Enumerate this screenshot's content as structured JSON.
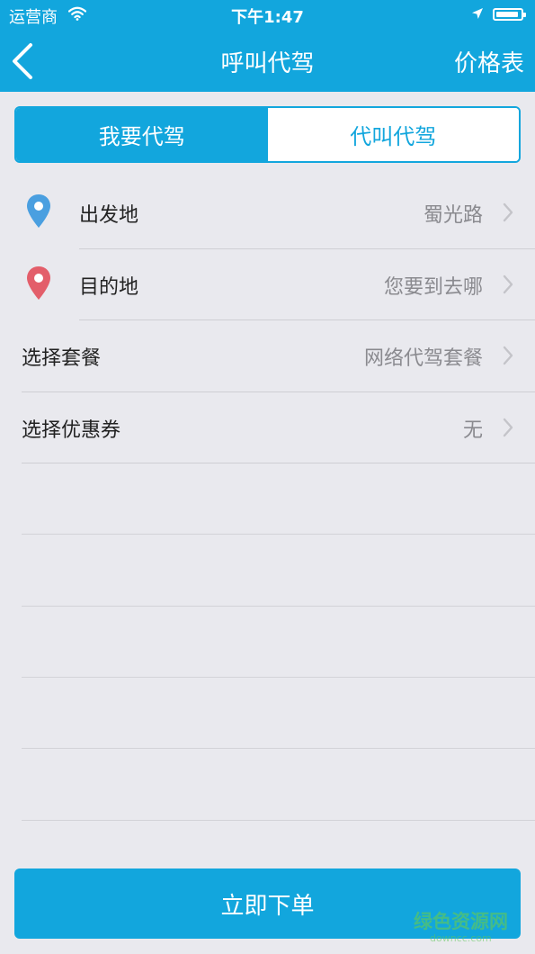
{
  "status_bar": {
    "carrier": "运营商",
    "time": "下午1:47",
    "battery_level": 0.92
  },
  "nav": {
    "title": "呼叫代驾",
    "right_action": "价格表"
  },
  "segments": [
    {
      "label": "我要代驾",
      "selected": true
    },
    {
      "label": "代叫代驾",
      "selected": false
    }
  ],
  "form": {
    "departure": {
      "label": "出发地",
      "value": "蜀光路"
    },
    "destination": {
      "label": "目的地",
      "value": "您要到去哪"
    },
    "package": {
      "label": "选择套餐",
      "value": "网络代驾套餐"
    },
    "coupon": {
      "label": "选择优惠券",
      "value": "无"
    }
  },
  "submit_label": "立即下单",
  "watermark": {
    "text": "绿色资源网",
    "sub": "downcc.com"
  },
  "colors": {
    "primary": "#12a6dd",
    "background": "#e9e9ee",
    "departure_pin": "#4a9fe0",
    "destination_pin": "#e35e6a"
  },
  "icons": [
    "back-arrow-icon",
    "wifi-icon",
    "location-arrow-icon",
    "battery-icon",
    "map-pin-icon",
    "chevron-right-icon"
  ]
}
